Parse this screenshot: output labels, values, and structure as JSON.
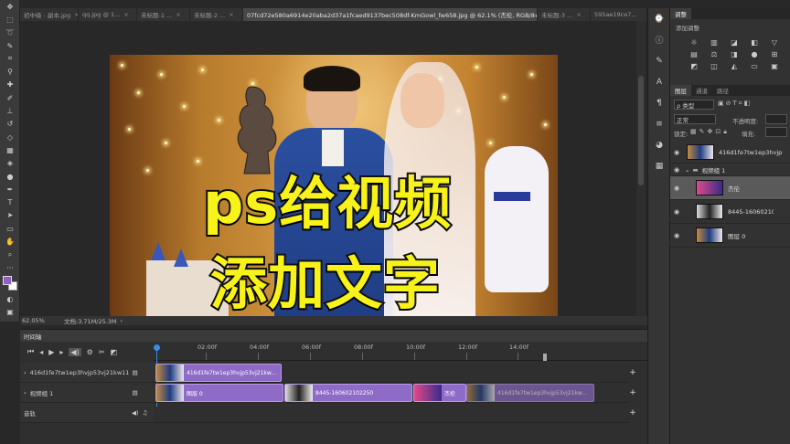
{
  "tabs": [
    {
      "label": "初中级 - 副本.jpg",
      "active": false
    },
    {
      "label": "qq.jpg @ 1...",
      "active": false
    },
    {
      "label": "未标题-1 ...",
      "active": false
    },
    {
      "label": "未标题-2 ...",
      "active": false
    },
    {
      "label": "07fcd72e580a6914e20aba2d37a1fcaed9137bec508df-KmGowl_fw658.jpg @ 62.1% (杰伦, RGB/8#)",
      "active": true
    },
    {
      "label": "未标题-3 ...",
      "active": false
    },
    {
      "label": "595ae19ce7...",
      "active": false
    }
  ],
  "overlay": {
    "line1": "ps给视频",
    "line2": "添加文字"
  },
  "status": {
    "zoom": "62.05%",
    "doc": "文档:3.71M/25.3M"
  },
  "timeline": {
    "title": "时间轴",
    "ruler": [
      "02:00f",
      "04:00f",
      "06:00f",
      "08:00f",
      "10:00f",
      "12:00f",
      "14:00f"
    ],
    "tracks": [
      {
        "label": "416d1fe7tw1ep3hvjp53vj21kw11zql0..."
      },
      {
        "label": "视频组 1"
      },
      {
        "label": "音轨"
      }
    ],
    "clips": {
      "track1": "416d1fe7tw1ep3hvjp53vj21kw...",
      "layer0": "图层 0",
      "clip8445": "8445-160602102250",
      "jielun": "杰伦",
      "track2_tail": "416d1fe7tw1ep3hvjp53vj21kw..."
    }
  },
  "panels": {
    "adjust_tab": "调整",
    "add_adjust": "添加调整",
    "layer_tabs": [
      "图层",
      "通道",
      "路径"
    ],
    "kind": "ρ 类型",
    "blend": "正常",
    "opacity_label": "不透明度:",
    "lock_label": "锁定:",
    "fill_label": "填充:",
    "layers": [
      {
        "name": "416d1fe7tw1ep3hvjp53vj21kw11zql0...",
        "indent": 0,
        "selected": false
      },
      {
        "name": "视频组 1",
        "indent": 0,
        "selected": false,
        "group": true
      },
      {
        "name": "杰伦",
        "indent": 1,
        "selected": true
      },
      {
        "name": "8445-160602102250",
        "indent": 1,
        "selected": false
      },
      {
        "name": "图层 0",
        "indent": 1,
        "selected": false
      }
    ]
  },
  "colors": {
    "accent": "#3b8de0",
    "clip": "#8e6bc6",
    "title_yellow": "#f7f21a",
    "foreground_swatch": "#8f5cd0"
  }
}
